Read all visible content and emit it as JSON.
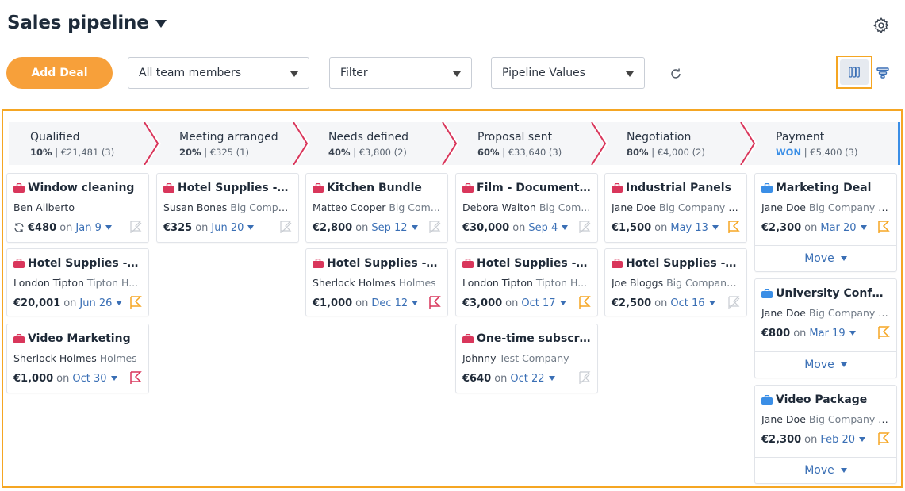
{
  "header": {
    "title": "Sales pipeline"
  },
  "toolbar": {
    "add_deal_label": "Add Deal",
    "team_select": "All team members",
    "filter_select": "Filter",
    "values_select": "Pipeline Values"
  },
  "colors": {
    "accent": "#f7a03a",
    "stage_divider": "#d9365b",
    "bag_red": "#d9365b",
    "bag_blue": "#3a8ee6",
    "won": "#3a8ee6"
  },
  "stages": [
    {
      "name": "Qualified",
      "pct": "10%",
      "total": "€21,481 (3)"
    },
    {
      "name": "Meeting arranged",
      "pct": "20%",
      "total": "€325 (1)"
    },
    {
      "name": "Needs defined",
      "pct": "40%",
      "total": "€3,800 (2)"
    },
    {
      "name": "Proposal sent",
      "pct": "60%",
      "total": "€33,640 (3)"
    },
    {
      "name": "Negotiation",
      "pct": "80%",
      "total": "€4,000 (2)"
    },
    {
      "name": "Payment",
      "pct": "WON",
      "total": "€5,400 (3)"
    }
  ],
  "separator": "|",
  "on_word": "on",
  "move_label": "Move",
  "cards": [
    {
      "title": "Window cleaning",
      "person": "Ben Allberto",
      "company": "",
      "value": "€480",
      "date": "Jan 9",
      "bag": "red",
      "flag": "none",
      "sync": true
    },
    {
      "title": "Hotel Supplies - Ca...",
      "person": "London Tipton",
      "company": "Tipton H...",
      "value": "€20,001",
      "date": "Jun 26",
      "bag": "red",
      "flag": "orange"
    },
    {
      "title": "Video Marketing",
      "person": "Sherlock Holmes",
      "company": "Holmes",
      "value": "€1,000",
      "date": "Oct 30",
      "bag": "red",
      "flag": "red"
    },
    {
      "title": "Hotel Supplies - De...",
      "person": "Susan Bones",
      "company": "Big Compa...",
      "value": "€325",
      "date": "Jun 20",
      "bag": "red",
      "flag": "none"
    },
    {
      "title": "Kitchen Bundle",
      "person": "Matteo Cooper",
      "company": "Big Com...",
      "value": "€2,800",
      "date": "Sep 12",
      "bag": "red",
      "flag": "none"
    },
    {
      "title": "Hotel Supplies - To...",
      "person": "Sherlock Holmes",
      "company": "Holmes",
      "value": "€1,000",
      "date": "Dec 12",
      "bag": "red",
      "flag": "red"
    },
    {
      "title": "Film - Documentary",
      "person": "Debora Walton",
      "company": "Big Com...",
      "value": "€30,000",
      "date": "Sep 4",
      "bag": "red",
      "flag": "none"
    },
    {
      "title": "Hotel Supplies - W...",
      "person": "London Tipton",
      "company": "Tipton H...",
      "value": "€3,000",
      "date": "Oct 17",
      "bag": "red",
      "flag": "orange"
    },
    {
      "title": "One-time subscrip...",
      "person": "Johnny",
      "company": "Test Company",
      "value": "€640",
      "date": "Oct 22",
      "bag": "red",
      "flag": "none"
    },
    {
      "title": "Industrial Panels",
      "person": "Jane Doe",
      "company": "Big Company Inc",
      "value": "€1,500",
      "date": "May 13",
      "bag": "red",
      "flag": "orange"
    },
    {
      "title": "Hotel Supplies - N...",
      "person": "Joe Bloggs",
      "company": "Big Company ...",
      "value": "€2,500",
      "date": "Oct 16",
      "bag": "red",
      "flag": "none"
    },
    {
      "title": "Marketing Deal",
      "person": "Jane Doe",
      "company": "Big Company Inc",
      "value": "€2,300",
      "date": "Mar 20",
      "bag": "blue",
      "flag": "orange",
      "move": true
    },
    {
      "title": "University Confere...",
      "person": "Jane Doe",
      "company": "Big Company Inc",
      "value": "€800",
      "date": "Mar 19",
      "bag": "blue",
      "flag": "orange",
      "move": true
    },
    {
      "title": "Video Package",
      "person": "Jane Doe",
      "company": "Big Company Inc",
      "value": "€2,300",
      "date": "Feb 20",
      "bag": "blue",
      "flag": "orange",
      "move": true
    }
  ]
}
